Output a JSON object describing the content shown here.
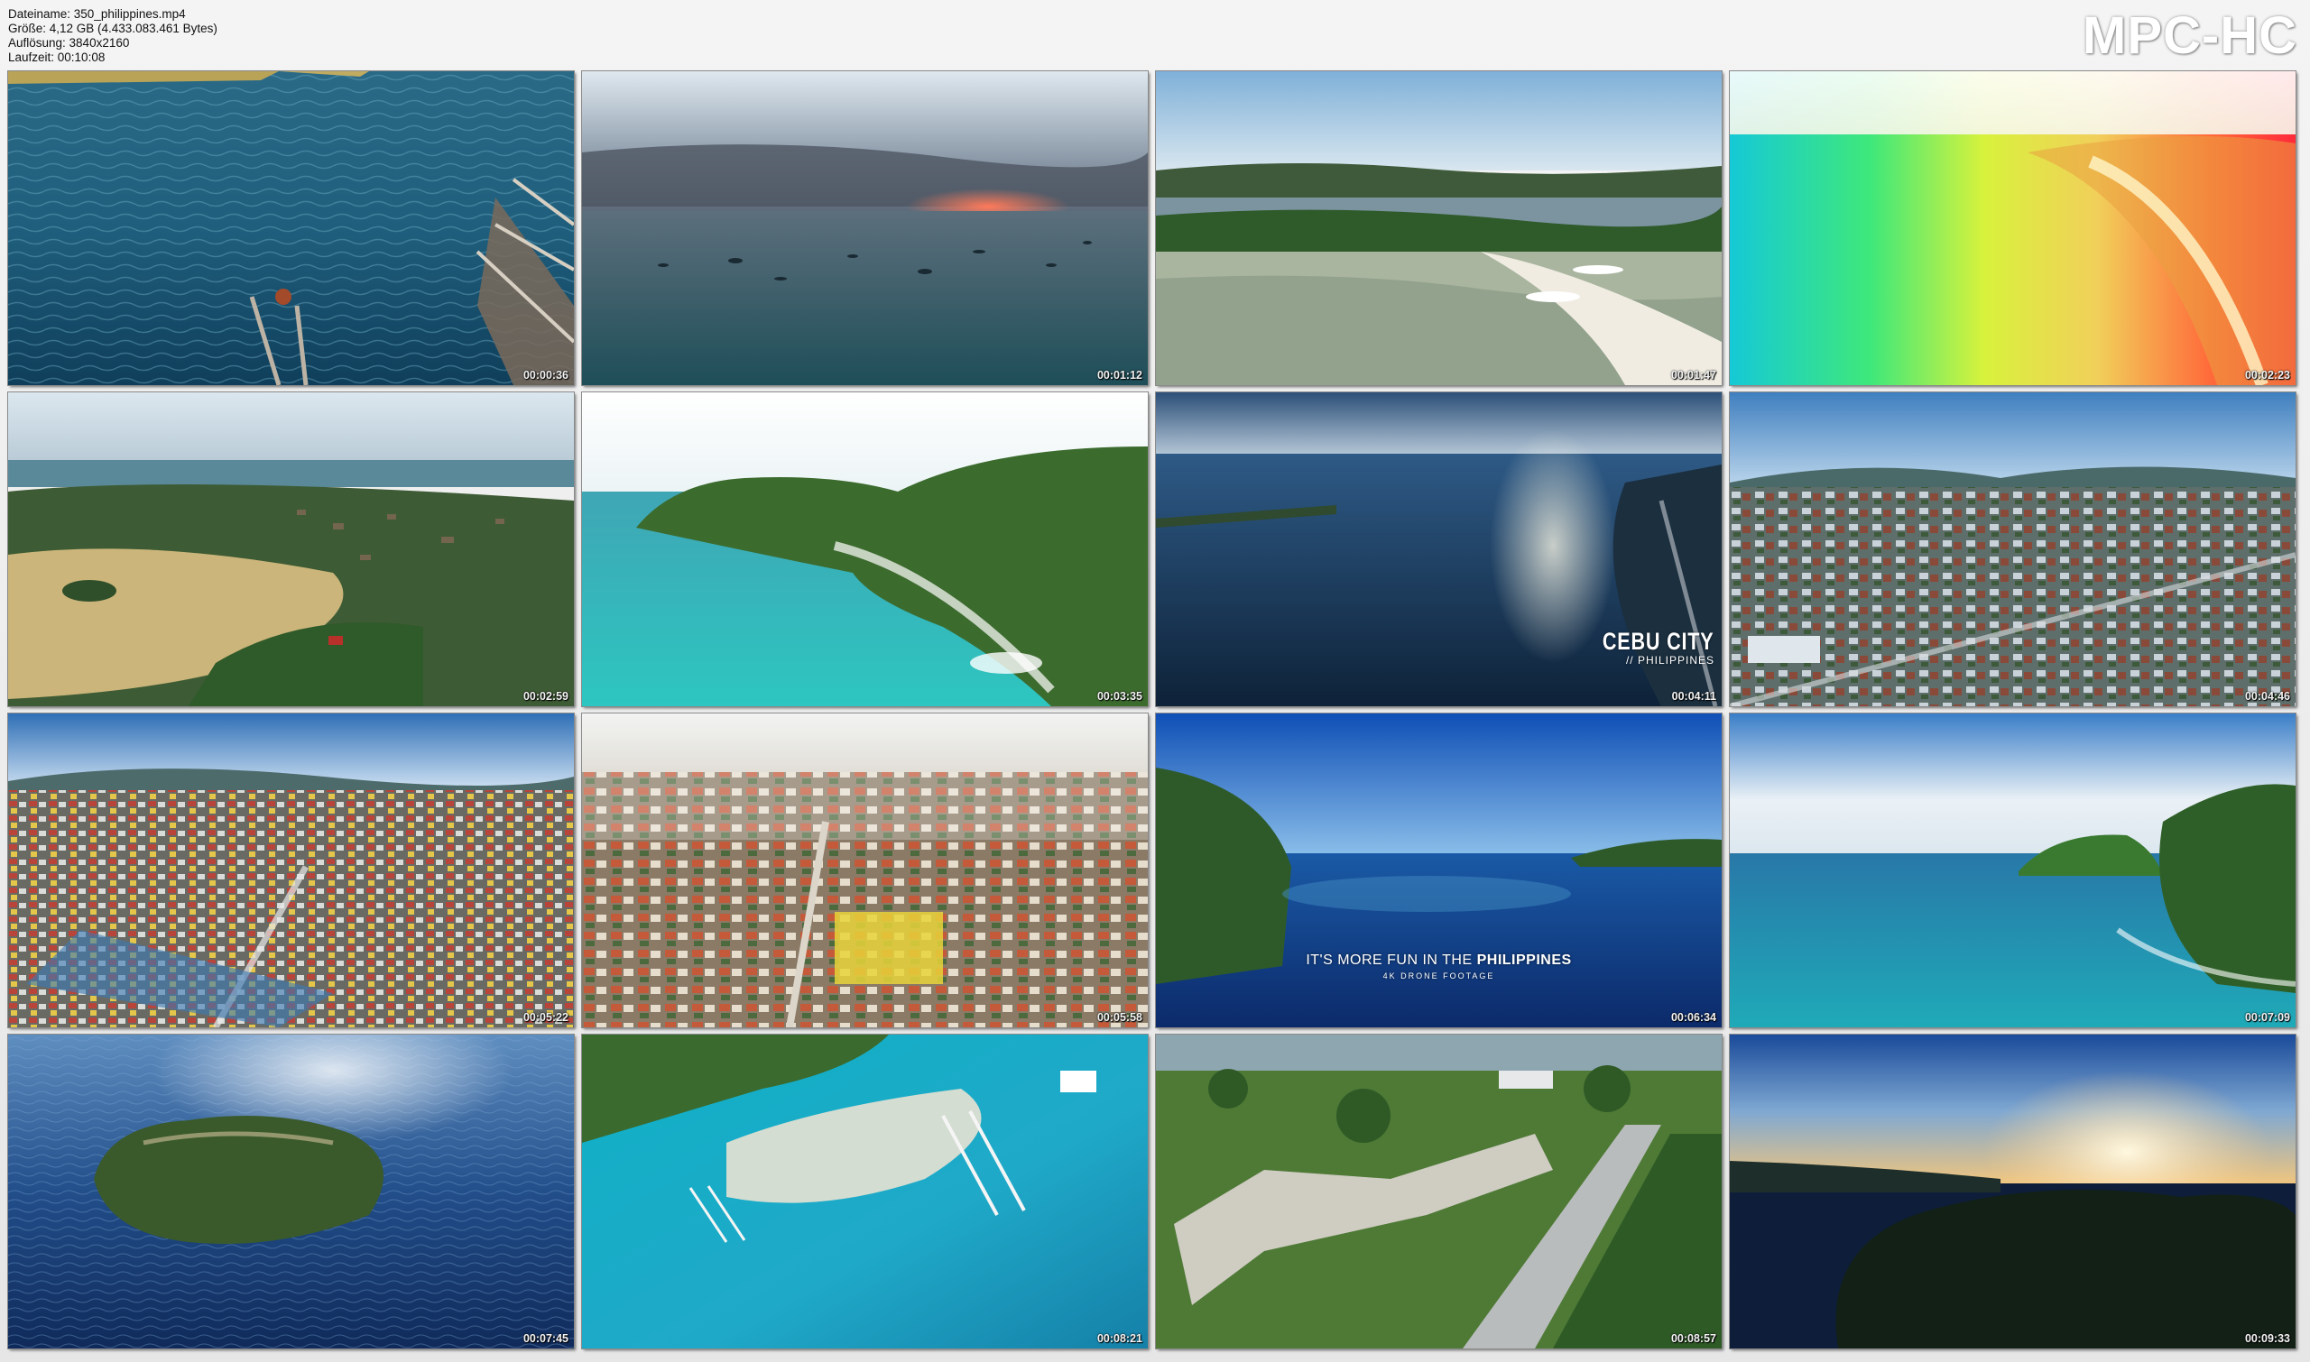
{
  "file_info": {
    "filename": "Dateiname: 350_philippines.mp4",
    "size": "Größe: 4,12 GB (4.433.083.461 Bytes)",
    "resolution": "Auflösung: 3840x2160",
    "duration": "Laufzeit: 00:10:08"
  },
  "logo": "MPC-HC",
  "thumbnails": [
    {
      "time": "00:00:36",
      "scene": "ocean-waves-boat-outrigger"
    },
    {
      "time": "00:01:12",
      "scene": "sunset-bay-boats"
    },
    {
      "time": "00:01:47",
      "scene": "aerial-lagoon-white-beach"
    },
    {
      "time": "00:02:23",
      "scene": "rainbow-colored-beach"
    },
    {
      "time": "00:02:59",
      "scene": "aerial-island-town-shallows"
    },
    {
      "time": "00:03:35",
      "scene": "jungle-headland-turquoise-sea"
    },
    {
      "time": "00:04:11",
      "scene": "cebu-coast-sun-reflection"
    },
    {
      "time": "00:04:46",
      "scene": "city-aerial-mountains"
    },
    {
      "time": "00:05:22",
      "scene": "city-aerial-dense"
    },
    {
      "time": "00:05:58",
      "scene": "city-aerial-hazy"
    },
    {
      "time": "00:06:34",
      "scene": "blue-bay-islands"
    },
    {
      "time": "00:07:09",
      "scene": "green-islet-clouds"
    },
    {
      "time": "00:07:45",
      "scene": "round-island-blue-sea"
    },
    {
      "time": "00:08:21",
      "scene": "outrigger-boats-turquoise"
    },
    {
      "time": "00:08:57",
      "scene": "fort-park-road"
    },
    {
      "time": "00:09:33",
      "scene": "sunset-silhouette-island"
    }
  ],
  "overlays": {
    "cebu_title": "CEBU CITY",
    "cebu_sub": "// PHILIPPINES",
    "fun_prefix": "IT'S MORE FUN IN THE",
    "fun_highlight": "PHILIPPINES",
    "fun_sub": "4K DRONE FOOTAGE"
  }
}
